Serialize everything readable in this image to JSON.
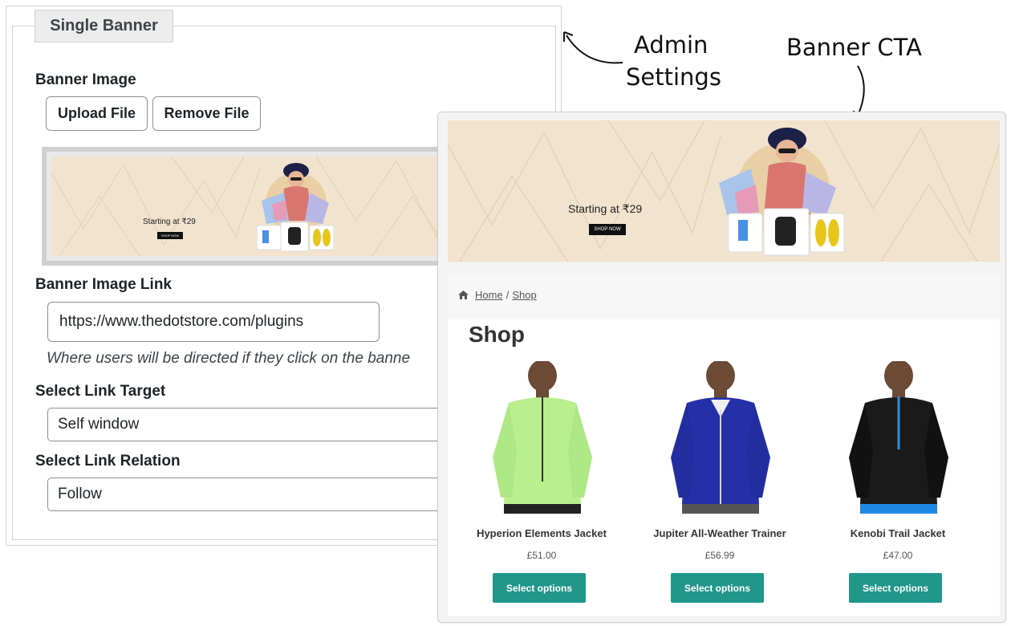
{
  "admin": {
    "legend": "Single Banner",
    "banner_image_label": "Banner Image",
    "upload_button": "Upload File",
    "remove_button": "Remove File",
    "banner_image_link_label": "Banner Image Link",
    "banner_image_link_value": "https://www.thedotstore.com/plugins",
    "banner_link_help": "Where users will be directed if they click on the banne",
    "link_target_label": "Select Link Target",
    "link_target_value": "Self window",
    "link_relation_label": "Select Link Relation",
    "link_relation_value": "Follow"
  },
  "banner": {
    "headline": "Starting at ₹29",
    "cta": "SHOP NOW",
    "background_color": "#f1e3ce",
    "circle_color": "#e9cfa6"
  },
  "annotations": {
    "admin_line1": "Admin",
    "admin_line2": "Settings",
    "banner_cta": "Banner CTA"
  },
  "shop": {
    "breadcrumb_home": "Home",
    "breadcrumb_separator": "/",
    "breadcrumb_current": "Shop",
    "title": "Shop",
    "button_color": "#21968b",
    "products": [
      {
        "name": "Hyperion Elements Jacket",
        "price": "£51.00",
        "button": "Select options",
        "jacket_color": "#b9f08d",
        "icon": "green-jacket-model"
      },
      {
        "name": "Jupiter All-Weather Trainer",
        "price": "£56.99",
        "button": "Select options",
        "jacket_color": "#2530a8",
        "icon": "blue-jacket-model"
      },
      {
        "name": "Kenobi Trail Jacket",
        "price": "£47.00",
        "button": "Select options",
        "jacket_color": "#1a1a1a",
        "icon": "black-jacket-model"
      }
    ]
  }
}
